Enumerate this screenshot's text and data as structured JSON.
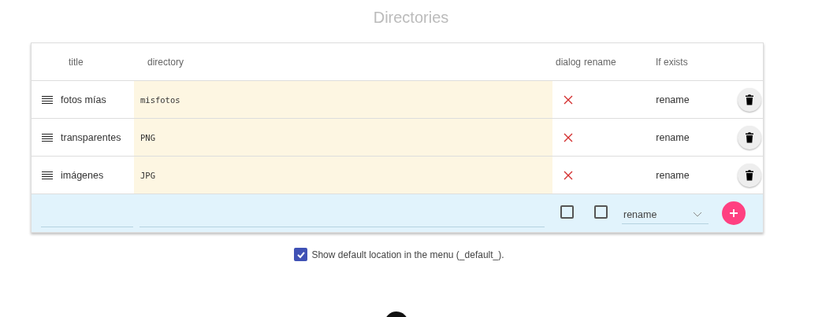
{
  "title": "Directories",
  "table": {
    "columns": [
      "title",
      "directory",
      "dialog",
      "rename",
      "If exists"
    ],
    "rows": [
      {
        "title": "fotos mías",
        "directory": "misfotos",
        "dialog": false,
        "if_exists": "rename"
      },
      {
        "title": "transparentes",
        "directory": "PNG",
        "dialog": false,
        "if_exists": "rename"
      },
      {
        "title": "imágenes",
        "directory": "JPG",
        "dialog": false,
        "if_exists": "rename"
      }
    ],
    "new_row": {
      "dialog": false,
      "rename": false,
      "if_exists": "rename"
    }
  },
  "default_option": {
    "label": "Show default location in the menu (_default_).",
    "checked": true
  }
}
